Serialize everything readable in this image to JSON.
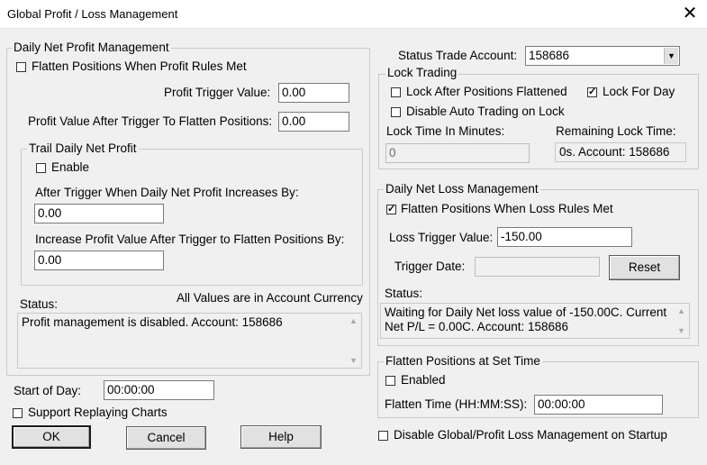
{
  "window": {
    "title": "Global Profit / Loss Management",
    "close_glyph": "✕"
  },
  "profit": {
    "legend": "Daily Net Profit Management",
    "flatten_label": "Flatten Positions When Profit Rules Met",
    "trigger_label": "Profit Trigger Value:",
    "trigger_value": "0.00",
    "after_label": "Profit Value After Trigger To Flatten Positions:",
    "after_value": "0.00",
    "trail": {
      "legend": "Trail Daily Net Profit",
      "enable_label": "Enable",
      "increase_label": "After Trigger When Daily Net Profit Increases By:",
      "increase_value": "0.00",
      "increase_after_label": "Increase Profit Value After Trigger to Flatten Positions By:",
      "increase_after_value": "0.00"
    },
    "status_label": "Status:",
    "currency_note": "All Values are in Account Currency",
    "status_text": "Profit management is disabled. Account: 158686"
  },
  "start_of_day": {
    "label": "Start of Day:",
    "value": "00:00:00"
  },
  "support_replay_label": "Support Replaying Charts",
  "buttons": {
    "ok": "OK",
    "cancel": "Cancel",
    "help": "Help",
    "reset": "Reset"
  },
  "status_account": {
    "label": "Status Trade Account:",
    "value": "158686"
  },
  "lock": {
    "legend": "Lock Trading",
    "after_flatten_label": "Lock After Positions Flattened",
    "after_flatten_checked": false,
    "for_day_label": "Lock For Day",
    "for_day_checked": true,
    "disable_auto_label": "Disable Auto Trading on Lock",
    "minutes_label": "Lock Time In Minutes:",
    "minutes_value": "0",
    "remaining_label": "Remaining Lock Time:",
    "remaining_value": "0s. Account: 158686"
  },
  "loss": {
    "legend": "Daily Net Loss Management",
    "flatten_label": "Flatten Positions When Loss Rules Met",
    "flatten_checked": true,
    "trigger_label": "Loss Trigger Value:",
    "trigger_value": "-150.00",
    "date_label": "Trigger Date:",
    "date_value": "",
    "status_label": "Status:",
    "status_text": "Waiting for Daily Net loss value of -150.00C.  Current Net P/L = 0.00C.  Account: 158686"
  },
  "set_time": {
    "legend": "Flatten Positions at Set Time",
    "enabled_label": "Enabled",
    "time_label": "Flatten Time (HH:MM:SS):",
    "time_value": "00:00:00"
  },
  "disable_global_label": "Disable Global/Profit Loss Management on Startup"
}
